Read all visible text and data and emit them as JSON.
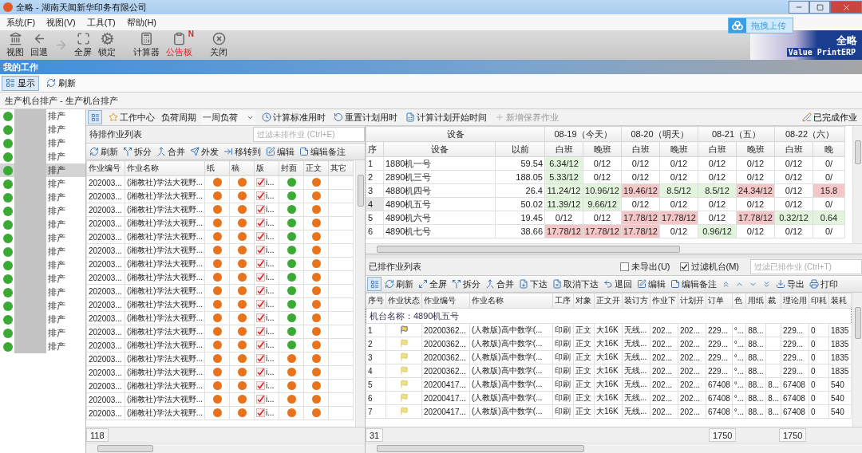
{
  "window": {
    "title": "全略 - 湖南天闻新华印务有限公司"
  },
  "menu": [
    "系统(F)",
    "视图(V)",
    "工具(T)",
    "帮助(H)"
  ],
  "upload_button": "拖拽上传",
  "toolbar": [
    {
      "label": "视图",
      "disabled": false
    },
    {
      "label": "回退",
      "disabled": false
    },
    {
      "disabled": true
    },
    {
      "label": "全屏",
      "disabled": false
    },
    {
      "label": "锁定",
      "disabled": false
    },
    {
      "label": "计算器",
      "disabled": false
    },
    {
      "label": "公告板",
      "disabled": false,
      "highlighted": true,
      "badge": "N"
    },
    {
      "label": "关闭",
      "disabled": false
    }
  ],
  "logo": {
    "name": "全略",
    "tagline": "Value PrintERP"
  },
  "panel_title": "我的工作",
  "view_buttons": [
    {
      "label": "显示",
      "selected": true
    },
    {
      "label": "刷新",
      "selected": false
    }
  ],
  "breadcrumb": "生产机台排产 - 生产机台排产",
  "machine_list": [
    {
      "label": "排产",
      "selected": false
    },
    {
      "label": "排产",
      "selected": false
    },
    {
      "label": "排产",
      "selected": false
    },
    {
      "label": "排产",
      "selected": false
    },
    {
      "label": "排产",
      "selected": true
    },
    {
      "label": "排产",
      "selected": false
    },
    {
      "label": "排产",
      "selected": false
    },
    {
      "label": "排产",
      "selected": false
    },
    {
      "label": "排产",
      "selected": false
    },
    {
      "label": "排产",
      "selected": false
    },
    {
      "label": "排产",
      "selected": false
    },
    {
      "label": "排产",
      "selected": false
    },
    {
      "label": "排产",
      "selected": false
    },
    {
      "label": "排产",
      "selected": false
    },
    {
      "label": "排产",
      "selected": false
    },
    {
      "label": "排产",
      "selected": false
    },
    {
      "label": "排产",
      "selected": false
    },
    {
      "label": "排产",
      "selected": false
    }
  ],
  "schedule_toolbar": {
    "work_center": "工作中心",
    "load_period_label": "负荷周期",
    "load_period_value": "一周负荷",
    "actions": [
      {
        "label": "计算标准用时",
        "disabled": false
      },
      {
        "label": "重置计划用时",
        "disabled": false
      },
      {
        "label": "计算计划开始时间",
        "disabled": false
      },
      {
        "label": "新增保养作业",
        "disabled": true
      }
    ],
    "completed": "已完成作业"
  },
  "pending": {
    "title": "待排作业列表",
    "filter_placeholder": "过滤未排作业 (Ctrl+E)",
    "actions": [
      "刷新",
      "拆分",
      "合并",
      "外发",
      "移转到",
      "编辑",
      "编辑备注"
    ],
    "columns": [
      "作业编号",
      "作业名称",
      "纸",
      "稿",
      "版",
      "封面",
      "正文",
      "其它"
    ],
    "rows": [
      {
        "id": "202003...",
        "name": "(湘教社)学法大视野...",
        "paper": {
          "color": "#e8731c"
        },
        "draft": {
          "color": "#e8731c"
        },
        "plate": {
          "checked": true,
          "text": "i..."
        },
        "cover": {
          "color": "#3aaa35"
        },
        "body": {
          "color": "#e8731c"
        }
      },
      {
        "id": "202003...",
        "name": "(湘教社)学法大视野...",
        "paper": {
          "color": "#e8731c"
        },
        "draft": {
          "color": "#e8731c"
        },
        "plate": {
          "checked": true,
          "text": "i..."
        },
        "cover": {
          "color": "#3aaa35"
        },
        "body": {
          "color": "#e8731c"
        }
      },
      {
        "id": "202003...",
        "name": "(湘教社)学法大视野...",
        "paper": {
          "color": "#e8731c"
        },
        "draft": {
          "color": "#e8731c"
        },
        "plate": {
          "checked": true,
          "text": "i..."
        },
        "cover": {
          "color": "#3aaa35"
        },
        "body": {
          "color": "#e8731c"
        }
      },
      {
        "id": "202003...",
        "name": "(湘教社)学法大视野...",
        "paper": {
          "color": "#e8731c"
        },
        "draft": {
          "color": "#e8731c"
        },
        "plate": {
          "checked": true,
          "text": "i..."
        },
        "cover": {
          "color": "#3aaa35"
        },
        "body": {
          "color": "#e8731c"
        }
      },
      {
        "id": "202003...",
        "name": "(湘教社)学法大视野...",
        "paper": {
          "color": "#e8731c"
        },
        "draft": {
          "color": "#e8731c"
        },
        "plate": {
          "checked": true,
          "text": "i..."
        },
        "cover": {
          "color": "#3aaa35"
        },
        "body": {
          "color": "#e8731c"
        }
      },
      {
        "id": "202003...",
        "name": "(湘教社)学法大视野...",
        "paper": {
          "color": "#e8731c"
        },
        "draft": {
          "color": "#e8731c"
        },
        "plate": {
          "checked": true,
          "text": "i..."
        },
        "cover": {
          "color": "#3aaa35"
        },
        "body": {
          "color": "#e8731c"
        }
      },
      {
        "id": "202003...",
        "name": "(湘教社)学法大视野...",
        "paper": {
          "color": "#e8731c"
        },
        "draft": {
          "color": "#e8731c"
        },
        "plate": {
          "checked": true,
          "text": "i..."
        },
        "cover": {
          "color": "#3aaa35"
        },
        "body": {
          "color": "#e8731c"
        }
      },
      {
        "id": "202003...",
        "name": "(湘教社)学法大视野...",
        "paper": {
          "color": "#e8731c"
        },
        "draft": {
          "color": "#e8731c"
        },
        "plate": {
          "checked": true,
          "text": "i..."
        },
        "cover": {
          "color": "#3aaa35"
        },
        "body": {
          "color": "#e8731c"
        }
      },
      {
        "id": "202003...",
        "name": "(湘教社)学法大视野...",
        "paper": {
          "color": "#e8731c"
        },
        "draft": {
          "color": "#e8731c"
        },
        "plate": {
          "checked": true,
          "text": "i..."
        },
        "cover": {
          "color": "#3aaa35"
        },
        "body": {
          "color": "#e8731c"
        }
      },
      {
        "id": "202003...",
        "name": "(湘教社)学法大视野...",
        "paper": {
          "color": "#e8731c"
        },
        "draft": {
          "color": "#e8731c"
        },
        "plate": {
          "checked": true,
          "text": "i..."
        },
        "cover": {
          "color": "#3aaa35"
        },
        "body": {
          "color": "#e8731c"
        }
      },
      {
        "id": "202003...",
        "name": "(湘教社)学法大视野...",
        "paper": {
          "color": "#e8731c"
        },
        "draft": {
          "color": "#e8731c"
        },
        "plate": {
          "checked": true,
          "text": "i..."
        },
        "cover": {
          "color": "#3aaa35"
        },
        "body": {
          "color": "#e8731c"
        }
      },
      {
        "id": "202003...",
        "name": "(湘教社)学法大视野...",
        "paper": {
          "color": "#e8731c"
        },
        "draft": {
          "color": "#e8731c"
        },
        "plate": {
          "checked": true,
          "text": "i..."
        },
        "cover": {
          "color": "#3aaa35"
        },
        "body": {
          "color": "#e8731c"
        }
      },
      {
        "id": "202003...",
        "name": "(湘教社)学法大视野...",
        "paper": {
          "color": "#e8731c"
        },
        "draft": {
          "color": "#e8731c"
        },
        "plate": {
          "checked": true,
          "text": "i..."
        },
        "cover": {
          "color": "#3aaa35"
        },
        "body": {
          "color": "#e8731c"
        }
      },
      {
        "id": "202003...",
        "name": "(湘教社)学法大视野...",
        "paper": {
          "color": "#e8731c"
        },
        "draft": {
          "color": "#e8731c"
        },
        "plate": {
          "checked": true,
          "text": "i..."
        },
        "cover": {
          "color": "#e8731c"
        },
        "body": {
          "color": "#e8731c"
        }
      },
      {
        "id": "202003...",
        "name": "(湘教社)学法大视野...",
        "paper": {
          "color": "#e8731c"
        },
        "draft": {
          "color": "#e8731c"
        },
        "plate": {
          "checked": true,
          "text": "i..."
        },
        "cover": {
          "color": "#e8731c"
        },
        "body": {
          "color": "#e8731c"
        }
      },
      {
        "id": "202003...",
        "name": "(湘教社)学法大视野...",
        "paper": {
          "color": "#e8731c"
        },
        "draft": {
          "color": "#e8731c"
        },
        "plate": {
          "checked": true,
          "text": "i..."
        },
        "cover": {
          "color": "#e8731c"
        },
        "body": {
          "color": "#e8731c"
        }
      },
      {
        "id": "202003...",
        "name": "(湘教社)学法大视野...",
        "paper": {
          "color": "#e8731c"
        },
        "draft": {
          "color": "#e8731c"
        },
        "plate": {
          "checked": true,
          "text": "i..."
        },
        "cover": {
          "color": "#e8731c"
        },
        "body": {
          "color": "#e8731c"
        }
      },
      {
        "id": "202003...",
        "name": "(湘教社)学法大视野...",
        "paper": {
          "color": "#e8731c"
        },
        "draft": {
          "color": "#e8731c"
        },
        "plate": {
          "checked": true,
          "text": "i..."
        },
        "cover": {
          "color": "#e8731c"
        },
        "body": {
          "color": "#e8731c"
        }
      }
    ],
    "count": "118"
  },
  "load": {
    "group_header": "设备",
    "days": [
      "08-19（今天）",
      "08-20（明天）",
      "08-21（五）",
      "08-22（六）"
    ],
    "columns": [
      "序",
      "设备",
      "以前"
    ],
    "shifts": [
      "白班",
      "晚班",
      "白班",
      "晚班",
      "白班",
      "晚班",
      "白班",
      "晚"
    ],
    "rows": [
      {
        "no": "1",
        "machine": "1880机一号",
        "before": "59.54",
        "selected": false,
        "cells": [
          {
            "text": "6.34/12",
            "color": "#e3f4dc"
          },
          {
            "text": "0/12"
          },
          {
            "text": "0/12"
          },
          {
            "text": "0/12"
          },
          {
            "text": "0/12"
          },
          {
            "text": "0/12"
          },
          {
            "text": "0/12"
          },
          {
            "text": "0/"
          }
        ]
      },
      {
        "no": "2",
        "machine": "2890机三号",
        "before": "188.05",
        "selected": false,
        "cells": [
          {
            "text": "5.33/12",
            "color": "#e3f4dc"
          },
          {
            "text": "0/12"
          },
          {
            "text": "0/12"
          },
          {
            "text": "0/12"
          },
          {
            "text": "0/12"
          },
          {
            "text": "0/12"
          },
          {
            "text": "0/12"
          },
          {
            "text": "0/"
          }
        ]
      },
      {
        "no": "3",
        "machine": "4880机四号",
        "before": "26.4",
        "selected": false,
        "cells": [
          {
            "text": "11.24/12",
            "color": "#e3f4dc"
          },
          {
            "text": "10.96/12",
            "color": "#e3f4dc"
          },
          {
            "text": "19.46/12",
            "color": "#f4c6c6"
          },
          {
            "text": "8.5/12",
            "color": "#e3f4dc"
          },
          {
            "text": "8.5/12",
            "color": "#e3f4dc"
          },
          {
            "text": "24.34/12",
            "color": "#f4c6c6"
          },
          {
            "text": "0/12"
          },
          {
            "text": "15.8",
            "color": "#f4c6c6"
          }
        ]
      },
      {
        "no": "4",
        "machine": "4890机五号",
        "before": "50.02",
        "selected": true,
        "cells": [
          {
            "text": "11.39/12",
            "color": "#e3f4dc"
          },
          {
            "text": "9.66/12",
            "color": "#e3f4dc"
          },
          {
            "text": "0/12"
          },
          {
            "text": "0/12"
          },
          {
            "text": "0/12"
          },
          {
            "text": "0/12"
          },
          {
            "text": "0/12"
          },
          {
            "text": "0/"
          }
        ]
      },
      {
        "no": "5",
        "machine": "4890机六号",
        "before": "19.45",
        "selected": false,
        "cells": [
          {
            "text": "0/12"
          },
          {
            "text": "0/12"
          },
          {
            "text": "17.78/12",
            "color": "#f4c6c6"
          },
          {
            "text": "17.78/12",
            "color": "#f4c6c6"
          },
          {
            "text": "0/12"
          },
          {
            "text": "17.78/12",
            "color": "#f4c6c6"
          },
          {
            "text": "0.32/12",
            "color": "#e3f4dc"
          },
          {
            "text": "0.64",
            "color": "#e3f4dc"
          }
        ]
      },
      {
        "no": "6",
        "machine": "4890机七号",
        "before": "38.66",
        "selected": false,
        "cells": [
          {
            "text": "17.78/12",
            "color": "#f4c6c6"
          },
          {
            "text": "17.78/12",
            "color": "#f4c6c6"
          },
          {
            "text": "17.78/12",
            "color": "#f4c6c6"
          },
          {
            "text": "0/12"
          },
          {
            "text": "0.96/12",
            "color": "#e3f4dc"
          },
          {
            "text": "0/12"
          },
          {
            "text": "0/12"
          },
          {
            "text": "0/"
          }
        ]
      }
    ]
  },
  "scheduled": {
    "title": "已排作业列表",
    "filters": [
      {
        "label": "未导出(U)",
        "checked": false
      },
      {
        "label": "过滤机台(M)",
        "checked": true
      }
    ],
    "filter_placeholder": "过滤已排作业 (Ctrl+T)",
    "actions": [
      "刷新",
      "全屏",
      "拆分",
      "合并",
      "下达",
      "取消下达",
      "退回",
      "编辑",
      "编辑备注"
    ],
    "export": "导出",
    "print": "打印",
    "columns": [
      "序号",
      "作业状态",
      "作业编号",
      "作业名称",
      "工序",
      "对象",
      "正文开",
      "装订方",
      "作业下",
      "计划开",
      "订单",
      "色",
      "用纸",
      "裁",
      "理论用",
      "印耗",
      "装耗"
    ],
    "group": "机台名称：4890机五号",
    "rows": [
      {
        "cells": [
          "1",
          {
            "kind": "alert"
          },
          "20200362...",
          "(人教版)高中数学(...",
          "印刷",
          "正文",
          "大16K",
          "无线...",
          "202...",
          "202...",
          "229...",
          "°...",
          "88...",
          null,
          "229...",
          "0",
          "1835"
        ]
      },
      {
        "cells": [
          "2",
          {
            "kind": "normal"
          },
          "20200362...",
          "(人教版)高中数学(...",
          "印刷",
          "正文",
          "大16K",
          "无线...",
          "202...",
          "202...",
          "229...",
          "°...",
          "88...",
          null,
          "229...",
          "0",
          "1835"
        ]
      },
      {
        "cells": [
          "3",
          {
            "kind": "normal"
          },
          "20200362...",
          "(人教版)高中数学(...",
          "印刷",
          "正文",
          "大16K",
          "无线...",
          "202...",
          "202...",
          "229...",
          "°...",
          "88...",
          null,
          "229...",
          "0",
          "1835"
        ]
      },
      {
        "cells": [
          "4",
          {
            "kind": "normal"
          },
          "20200362...",
          "(人教版)高中数学(...",
          "印刷",
          "正文",
          "大16K",
          "无线...",
          "202...",
          "202...",
          "229...",
          "°...",
          "88...",
          null,
          "229...",
          "0",
          "1835"
        ]
      },
      {
        "cells": [
          "5",
          {
            "kind": "normal"
          },
          "20200417...",
          "(人教版)高中数学(...",
          "印刷",
          "正文",
          "大16K",
          "无线...",
          "202...",
          "202...",
          "67408",
          "°...",
          "88...",
          "8...",
          "67408",
          "0",
          "540"
        ]
      },
      {
        "cells": [
          "6",
          {
            "kind": "normal"
          },
          "20200417...",
          "(人教版)高中数学(...",
          "印刷",
          "正文",
          "大16K",
          "无线...",
          "202...",
          "202...",
          "67408",
          "°...",
          "88...",
          "8...",
          "67408",
          "0",
          "540"
        ]
      },
      {
        "cells": [
          "7",
          {
            "kind": "normal"
          },
          "20200417...",
          "(人教版)高中数学(...",
          "印刷",
          "正文",
          "大16K",
          "无线...",
          "202...",
          "202...",
          "67408",
          "°...",
          "88...",
          "8...",
          "67408",
          "0",
          "540"
        ]
      }
    ],
    "count": "31",
    "order_total": "1750",
    "theory_total": "1750"
  }
}
